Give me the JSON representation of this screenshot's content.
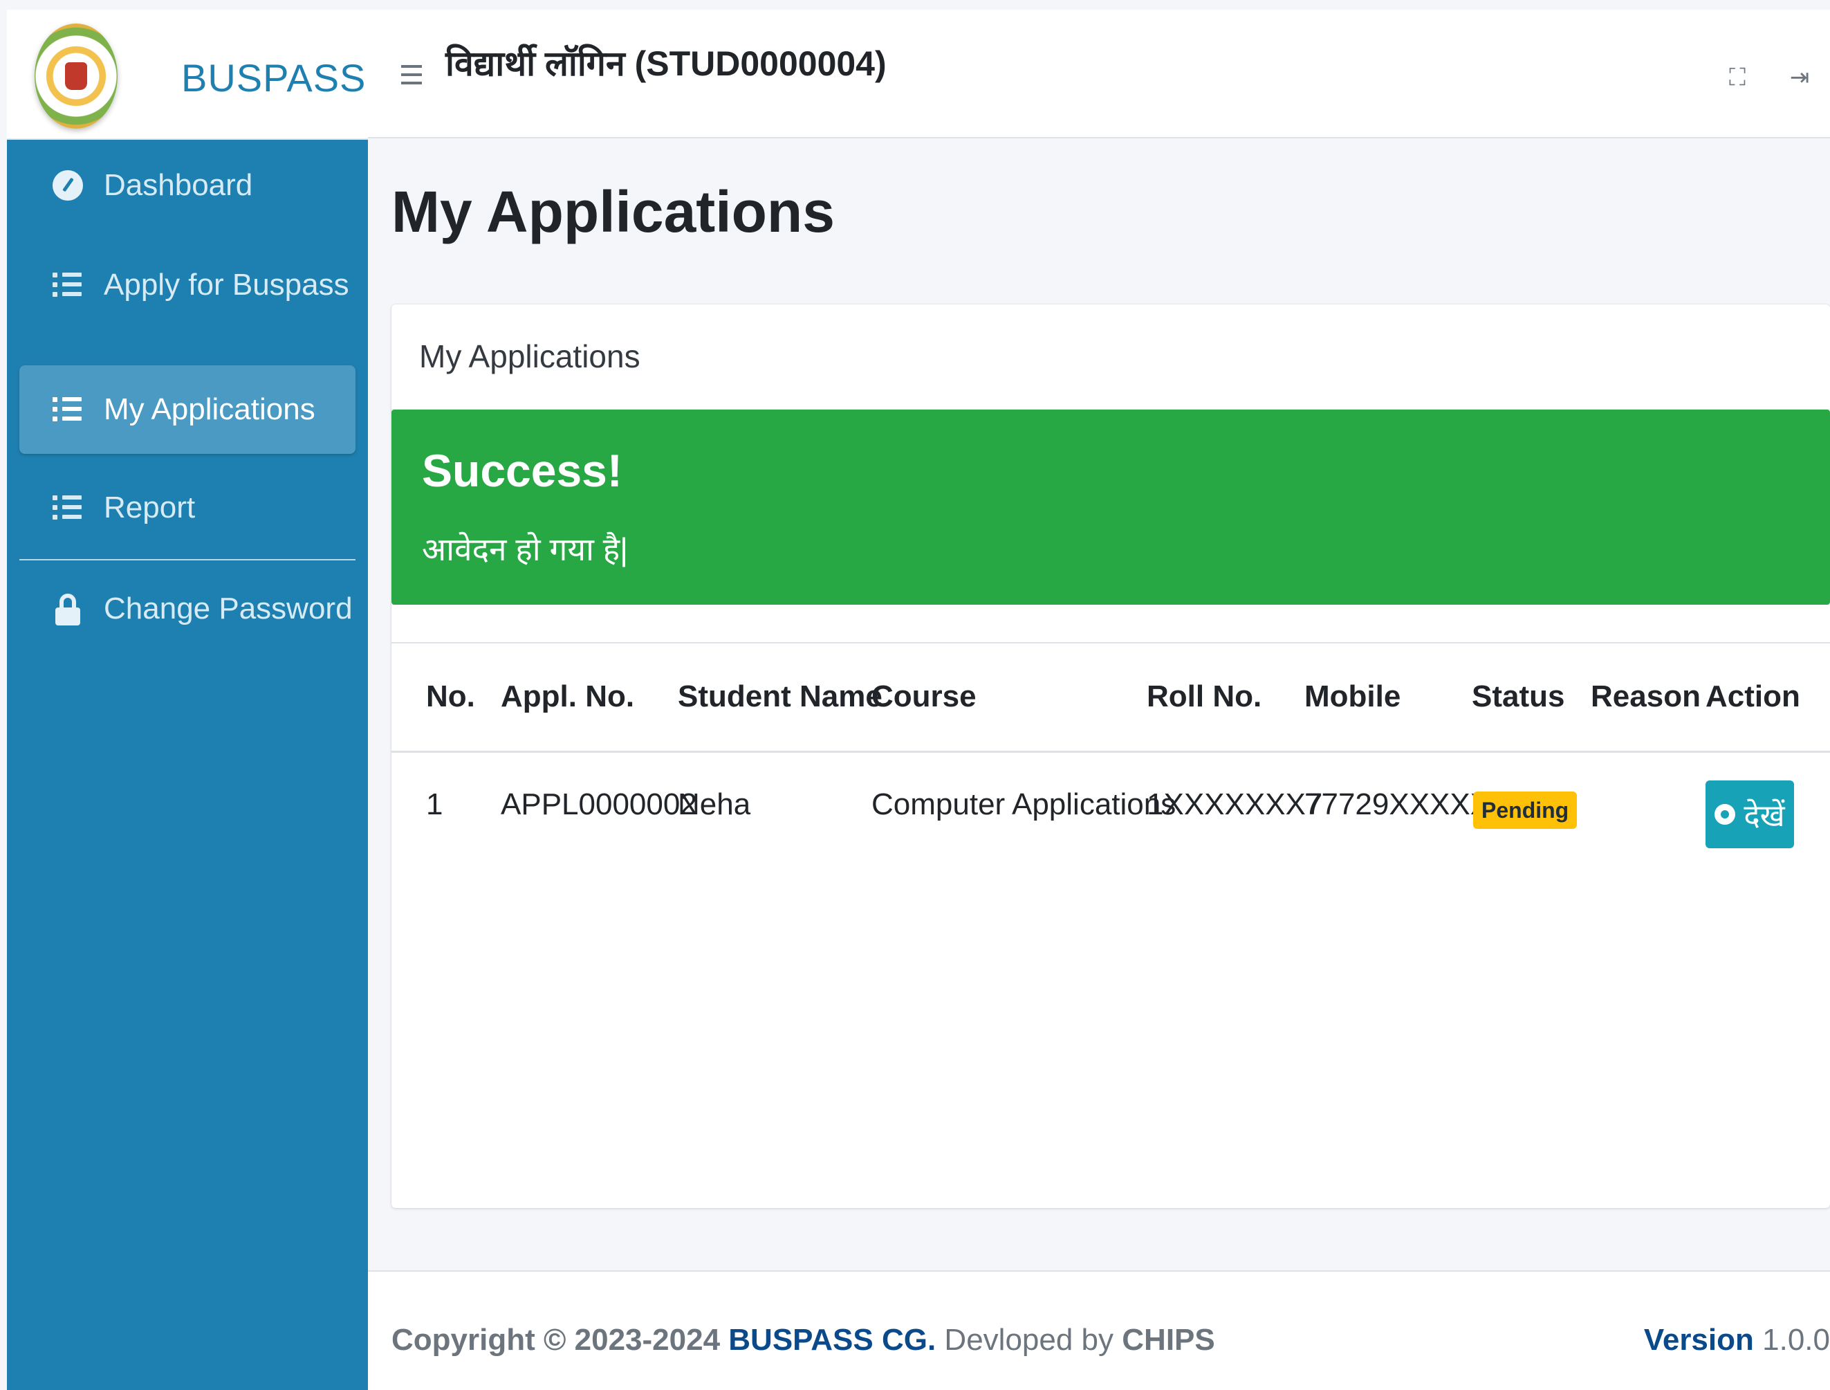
{
  "brand": {
    "name": "BUSPASS"
  },
  "sidebar": {
    "items": [
      {
        "label": "Dashboard",
        "icon": "dashboard-icon"
      },
      {
        "label": "Apply for Buspass",
        "icon": "list-icon"
      },
      {
        "label": "My Applications",
        "icon": "list-icon",
        "active": true
      },
      {
        "label": "Report",
        "icon": "list-icon"
      },
      {
        "label": "Change Password",
        "icon": "lock-icon"
      }
    ]
  },
  "header": {
    "title": "विद्यार्थी लॉगिन (STUD0000004)",
    "icons": [
      "expand-icon",
      "logout-icon"
    ]
  },
  "main": {
    "page_title": "My Applications",
    "card_title": "My Applications",
    "alert": {
      "heading": "Success!",
      "message": "आवेदन हो गया है|"
    },
    "table": {
      "columns": [
        "No.",
        "Appl. No.",
        "Student Name",
        "Course",
        "Roll No.",
        "Mobile",
        "Status",
        "Reason",
        "Action"
      ],
      "rows": [
        {
          "no": "1",
          "appl_no": "APPL0000002",
          "student_name": "Neha",
          "course": "Computer Applications",
          "roll_no": "1XXXXXXX7",
          "mobile": "77729XXXXX",
          "status": "Pending",
          "reason": "",
          "action": "देखें"
        }
      ]
    }
  },
  "footer": {
    "copyright_prefix": "Copyright © 2023-2024",
    "brand": "BUSPASS CG.",
    "developed_by": "Devloped by",
    "developer": "CHIPS",
    "version_label": "Version",
    "version_number": "1.0.0"
  },
  "colors": {
    "sidebar": "#1e80b0",
    "active_item": "#4a9ac3",
    "success": "#28a745",
    "warning": "#ffc107",
    "info": "#17a2b8"
  }
}
